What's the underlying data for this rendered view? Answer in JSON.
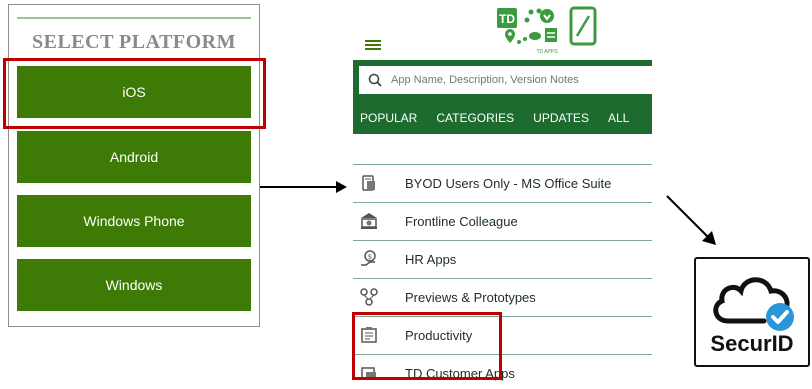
{
  "platform_panel": {
    "title": "SELECT PLATFORM",
    "buttons": [
      "iOS",
      "Android",
      "Windows Phone",
      "Windows"
    ],
    "selected": "iOS"
  },
  "app": {
    "logo_text": "TD APPS",
    "logo_mark": "TD",
    "search_placeholder": "App Name, Description, Version Notes",
    "nav_tabs": [
      "POPULAR",
      "CATEGORIES",
      "UPDATES",
      "ALL"
    ],
    "categories": [
      {
        "label": "BYOD Users Only - MS Office Suite",
        "icon": "byod-icon"
      },
      {
        "label": "Frontline Colleague",
        "icon": "bank-icon"
      },
      {
        "label": "HR Apps",
        "icon": "hr-icon"
      },
      {
        "label": "Previews & Prototypes",
        "icon": "prototype-icon"
      },
      {
        "label": "Productivity",
        "icon": "productivity-icon"
      },
      {
        "label": "TD Customer Apps",
        "icon": "customer-apps-icon"
      }
    ],
    "highlighted_category": "Productivity"
  },
  "securid": {
    "label": "SecurID",
    "icon": "cloud-check-icon"
  },
  "colors": {
    "platform_green": "#3d7b06",
    "app_green": "#1d6b2f",
    "highlight_red": "#c00000",
    "check_blue": "#2a96d8"
  }
}
